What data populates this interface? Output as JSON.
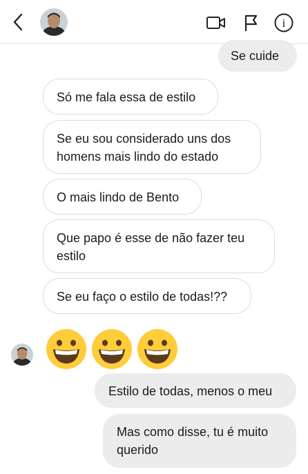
{
  "header": {
    "back": "back-chevron-icon",
    "avatar": "profile-photo",
    "icons": [
      "video-camera-icon",
      "flag-icon",
      "info-icon"
    ],
    "info_glyph": "i"
  },
  "messages": [
    {
      "from": "me",
      "text": "Se cuide"
    },
    {
      "from": "them",
      "text": "Só me fala essa de estilo"
    },
    {
      "from": "them",
      "lines": [
        "Se eu sou considerado uns dos",
        "homens mais lindo do estado"
      ]
    },
    {
      "from": "them",
      "text": "O mais lindo de Bento"
    },
    {
      "from": "them",
      "lines": [
        "Que papo é esse de não fazer teu",
        "estilo"
      ]
    },
    {
      "from": "them",
      "text": "Se eu faço o estilo de todas!??"
    },
    {
      "from": "them",
      "emojis": [
        "😄",
        "😄",
        "😄"
      ]
    },
    {
      "from": "me",
      "text": "Estilo de todas, menos o meu"
    },
    {
      "from": "me",
      "lines": [
        "Mas como disse, tu é muito",
        "querido"
      ]
    }
  ],
  "colors": {
    "sent_bubble": "#ececec",
    "received_border": "#dcdcdc",
    "icon_stroke": "#222222",
    "emoji_yellow": "#ffcc3a"
  }
}
